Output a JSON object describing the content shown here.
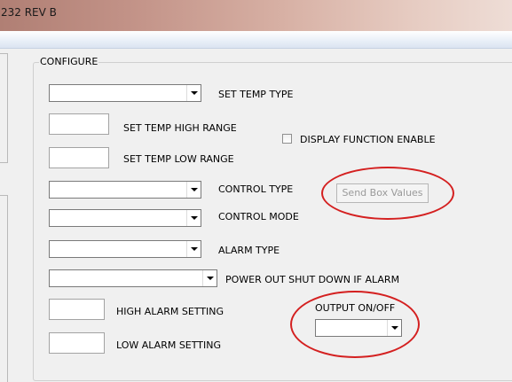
{
  "window": {
    "title": "232 REV B"
  },
  "configure": {
    "legend": "CONFIGURE",
    "set_temp_type": {
      "label": "SET TEMP TYPE",
      "value": ""
    },
    "set_temp_high_range": {
      "label": "SET TEMP HIGH RANGE",
      "value": ""
    },
    "set_temp_low_range": {
      "label": "SET TEMP LOW RANGE",
      "value": ""
    },
    "display_function_enable": {
      "label": "DISPLAY FUNCTION ENABLE",
      "checked": false
    },
    "control_type": {
      "label": "CONTROL TYPE",
      "value": ""
    },
    "control_mode": {
      "label": "CONTROL MODE",
      "value": ""
    },
    "alarm_type": {
      "label": "ALARM TYPE",
      "value": ""
    },
    "power_out_shut_down": {
      "label": "POWER OUT SHUT DOWN IF ALARM",
      "value": ""
    },
    "high_alarm_setting": {
      "label": "HIGH ALARM SETTING",
      "value": ""
    },
    "low_alarm_setting": {
      "label": "LOW ALARM SETTING",
      "value": ""
    },
    "output_on_off": {
      "label": "OUTPUT ON/OFF",
      "value": ""
    },
    "send_box_values_label": "Send Box Values"
  },
  "colors": {
    "highlight_circle": "#d42020",
    "disabled_text": "#9a9a9a"
  }
}
